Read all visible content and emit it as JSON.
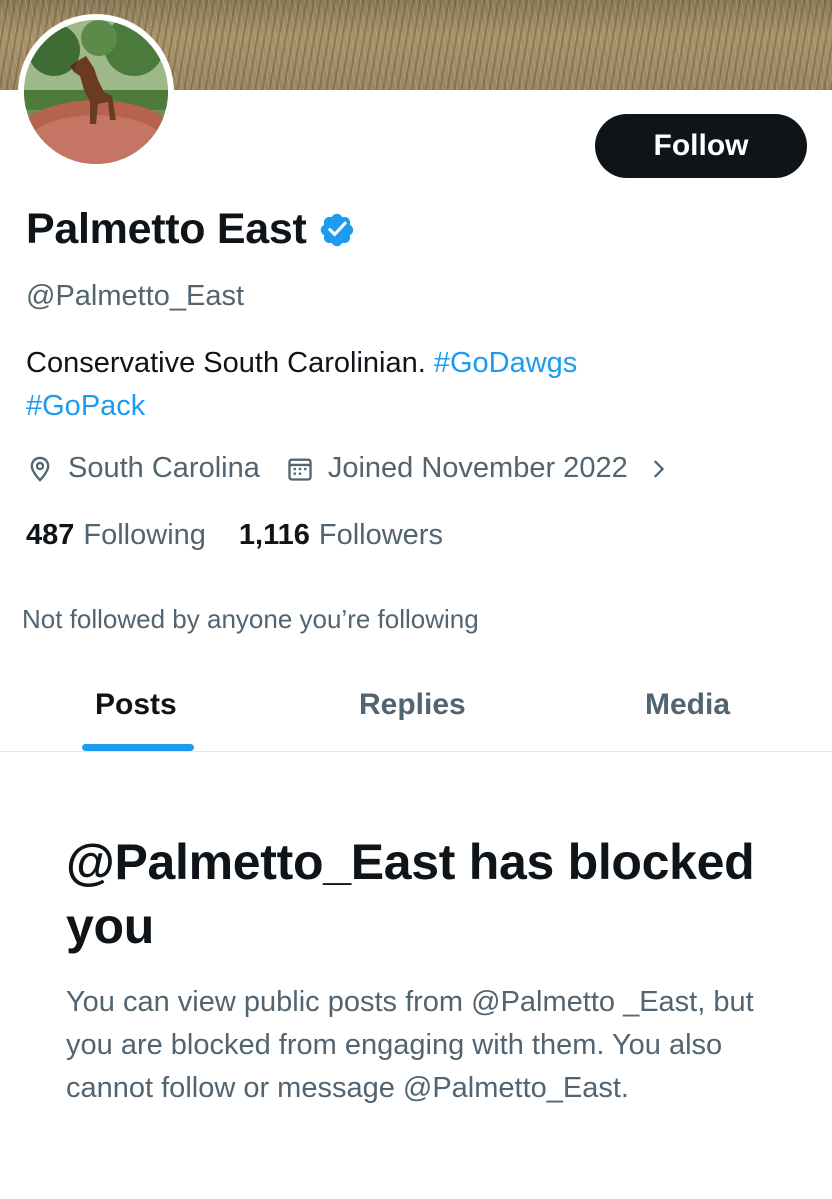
{
  "profile": {
    "display_name": "Palmetto East",
    "handle": "@Palmetto_East",
    "bio_text": "Conservative South Carolinian. ",
    "bio_hashtags": [
      "#GoDawgs",
      "#GoPack"
    ],
    "location": "South Carolina",
    "joined": "Joined November 2022",
    "following_count": "487",
    "following_label": "Following",
    "followers_count": "1,116",
    "followers_label": "Followers",
    "not_followed_note": "Not followed by anyone you’re following"
  },
  "actions": {
    "follow_label": "Follow"
  },
  "tabs": [
    {
      "label": "Posts",
      "active": true
    },
    {
      "label": "Replies",
      "active": false
    },
    {
      "label": "Media",
      "active": false
    }
  ],
  "blocked": {
    "title": "@Palmetto_East has blocked you",
    "message": "You can view public posts from @Palmetto _East, but you are blocked from engaging with them. You also cannot follow or message @Palmetto_East."
  },
  "icons": {
    "verified": "verified-badge-icon",
    "location": "location-pin-icon",
    "calendar": "calendar-icon",
    "chevron": "chevron-right-icon"
  },
  "colors": {
    "accent": "#1d9bf0",
    "text_primary": "#0f1419",
    "text_secondary": "#536471",
    "button_bg": "#0f1419"
  }
}
